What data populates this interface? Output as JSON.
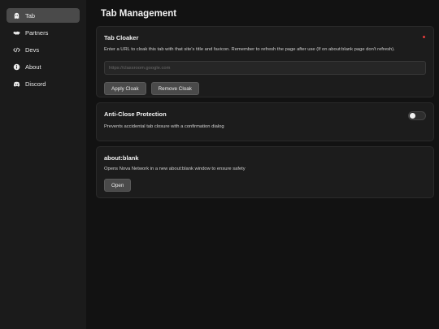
{
  "sidebar": {
    "items": [
      {
        "label": "Tab",
        "icon": "ghost-icon",
        "active": true
      },
      {
        "label": "Partners",
        "icon": "handshake-icon"
      },
      {
        "label": "Devs",
        "icon": "code-icon"
      },
      {
        "label": "About",
        "icon": "info-icon"
      },
      {
        "label": "Discord",
        "icon": "discord-icon"
      }
    ]
  },
  "main": {
    "title": "Tab Management",
    "cloaker": {
      "title": "Tab Cloaker",
      "description": "Enter a URL to cloak this tab with that site's title and favicon. Remember to refresh the page after use (If on about:blank page don't refresh).",
      "input_placeholder": "https://classroom.google.com",
      "input_value": "",
      "apply_label": "Apply Cloak",
      "remove_label": "Remove Cloak",
      "status_color": "#e23b3b"
    },
    "anti_close": {
      "title": "Anti-Close Protection",
      "description": "Prevents accidental tab closure with a confirmation dialog",
      "enabled": false
    },
    "about_blank": {
      "title": "about:blank",
      "description": "Opens Nova Network in a new about:blank window to ensure safety",
      "open_label": "Open"
    }
  },
  "colors": {
    "background": "#121212",
    "sidebar": "#1b1b1b",
    "card": "#1c1c1c",
    "active_item": "#4a4a4a"
  }
}
